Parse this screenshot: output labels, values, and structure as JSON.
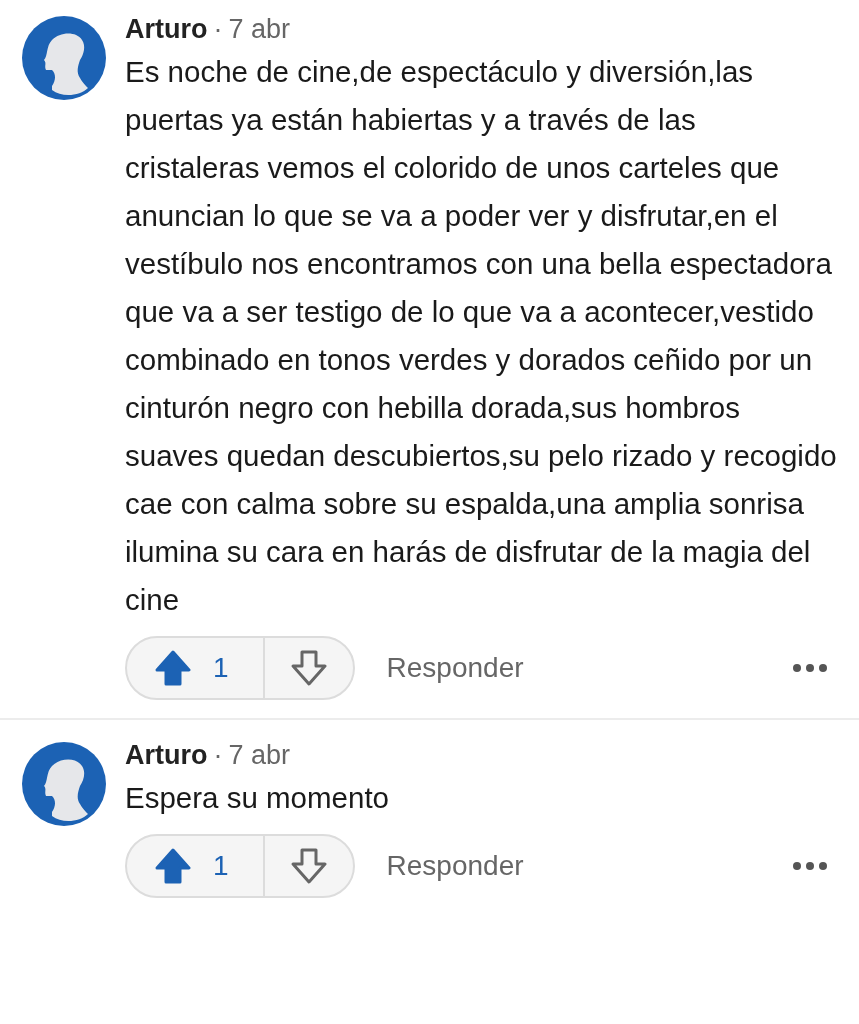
{
  "comments": [
    {
      "author": "Arturo",
      "separator": "·",
      "time": "7 abr",
      "body": "Es noche de cine,de espectáculo y diversión,las puertas ya están habiertas y a través de las cristaleras vemos el colorido de unos carteles que anuncian lo que se va a poder ver y disfrutar,en el vestíbulo nos encontramos con una bella espectadora que va a ser testigo de lo que va a acontecer,vestido combinado en tonos verdes y dorados ceñido por un cinturón negro con hebilla dorada,sus hombros suaves quedan descubiertos,su pelo rizado y recogido cae con calma sobre su espalda,una amplia sonrisa ilumina su cara en harás de disfrutar de la magia del cine",
      "upvoted": true,
      "downvoted": false,
      "score": "1",
      "reply": "Responder"
    },
    {
      "author": "Arturo",
      "separator": "·",
      "time": "7 abr",
      "body": "Espera su momento",
      "upvoted": true,
      "downvoted": false,
      "score": "1",
      "reply": "Responder"
    }
  ]
}
